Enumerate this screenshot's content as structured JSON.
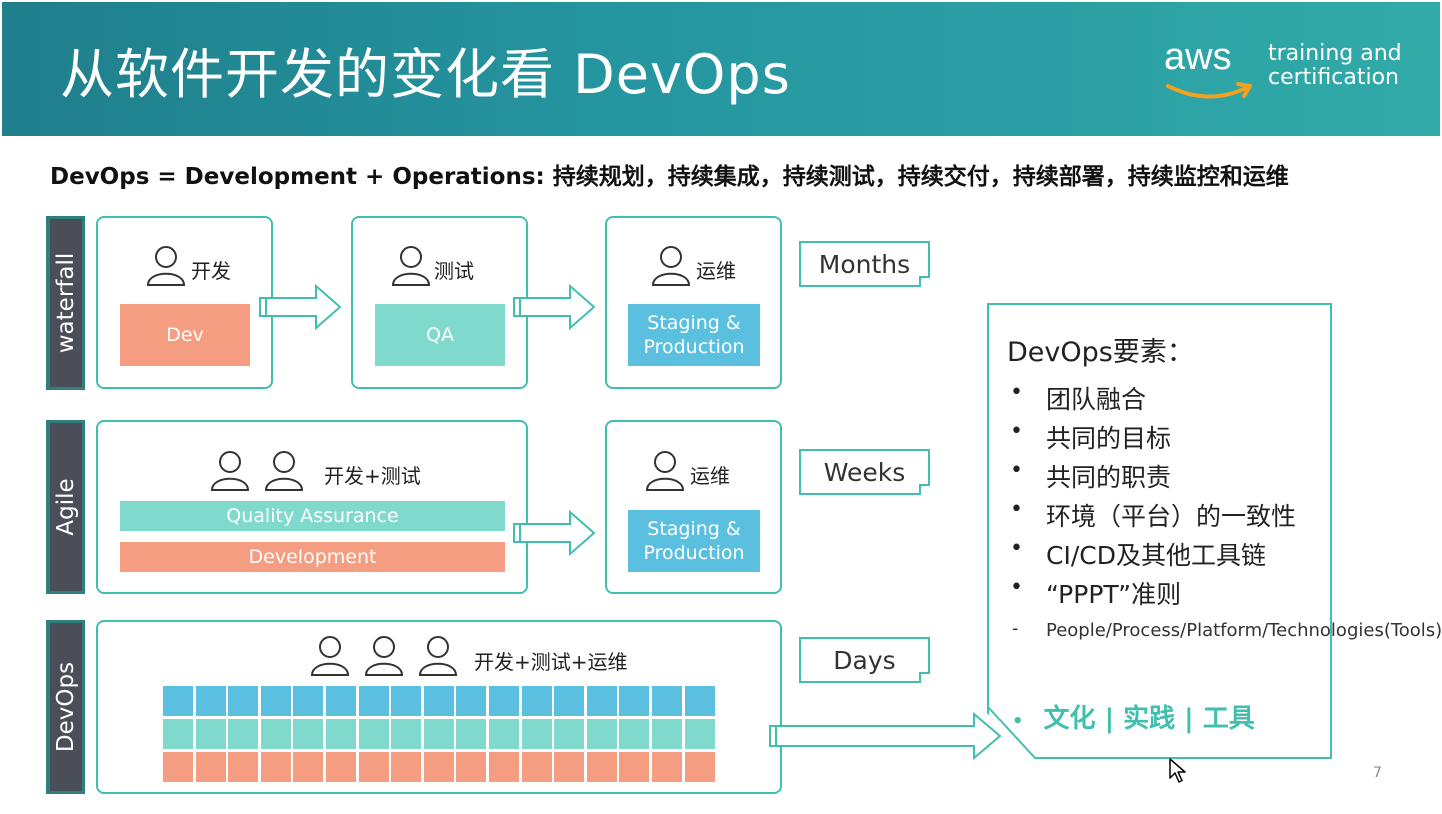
{
  "header": {
    "title": "从软件开发的变化看 DevOps",
    "logo_word": "aws",
    "logo_sub": [
      "training and",
      "certification"
    ]
  },
  "subtitle": "DevOps = Development + Operations: 持续规划，持续集成，持续测试，持续交付，持续部署，持续监控和运维",
  "rows": {
    "waterfall": {
      "label": "waterfall",
      "dev": {
        "role": "开发",
        "bar": "Dev"
      },
      "qa": {
        "role": "测试",
        "bar": "QA"
      },
      "ops": {
        "role": "运维",
        "bar": "Staging & Production"
      },
      "duration": "Months"
    },
    "agile": {
      "label": "Agile",
      "team": {
        "role": "开发+测试",
        "bar_qa": "Quality Assurance",
        "bar_dev": "Development"
      },
      "ops": {
        "role": "运维",
        "bar": "Staging & Production"
      },
      "duration": "Weeks"
    },
    "devops": {
      "label": "DevOps",
      "team": {
        "role": "开发+测试+运维"
      },
      "duration": "Days"
    }
  },
  "elements": {
    "title": "DevOps要素：",
    "items": [
      "团队融合",
      "共同的目标",
      "共同的职责",
      "环境（平台）的一致性",
      "CI/CD及其他工具链",
      "“PPPT”准则"
    ],
    "bullet": "•",
    "dash": "-",
    "dash_text": "People/Process/Platform/Technologies(Tools)",
    "culture": "文化 | 实践 | 工具"
  },
  "page_number": "7",
  "colors": {
    "header_teal": "#2596a0",
    "accent_teal": "#40bfae",
    "dev_orange": "#f59d80",
    "qa_teal": "#7fd9cd",
    "ops_blue": "#5bbfdf",
    "label_dark": "#4a4e58"
  }
}
